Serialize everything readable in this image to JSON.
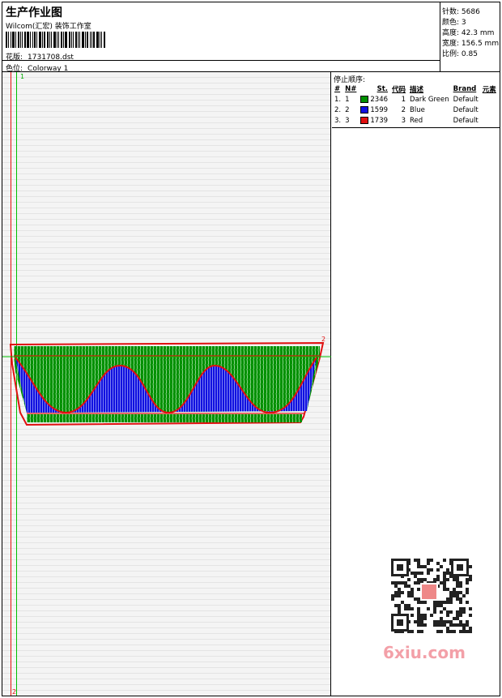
{
  "header": {
    "title": "生产作业图",
    "studio": "Wilcom(汇宏) 装饰工作室",
    "design_label": "花版:",
    "design_file": "1731708.dst",
    "colorway_label": "色位:",
    "colorway": "Colorway 1"
  },
  "stats": {
    "stitches_label": "针数:",
    "stitches": "5686",
    "colors_label": "颜色:",
    "colors": "3",
    "height_label": "高度:",
    "height": "42.3 mm",
    "width_label": "宽度:",
    "width": "156.5 mm",
    "scale_label": "比例:",
    "scale": "0.85"
  },
  "markers": {
    "top": "1",
    "bottom": "2",
    "end": "2"
  },
  "stop_sequence": {
    "title": "停止顺序:",
    "columns": [
      "#",
      "N#",
      "St.",
      "代码",
      "描述",
      "Brand",
      "元素"
    ],
    "rows": [
      {
        "num": "1.",
        "n": "1",
        "color": "#009000",
        "stitches": "2346",
        "code": "1",
        "desc": "Dark Green",
        "brand": "Default"
      },
      {
        "num": "2.",
        "n": "2",
        "color": "#1010e0",
        "stitches": "1599",
        "code": "2",
        "desc": "Blue",
        "brand": "Default"
      },
      {
        "num": "3.",
        "n": "3",
        "color": "#e01010",
        "stitches": "1739",
        "code": "3",
        "desc": "Red",
        "brand": "Default"
      }
    ]
  },
  "watermark": "6xiu.com",
  "palette": {
    "green": "#009000",
    "blue": "#1010e0",
    "red": "#e01010"
  }
}
